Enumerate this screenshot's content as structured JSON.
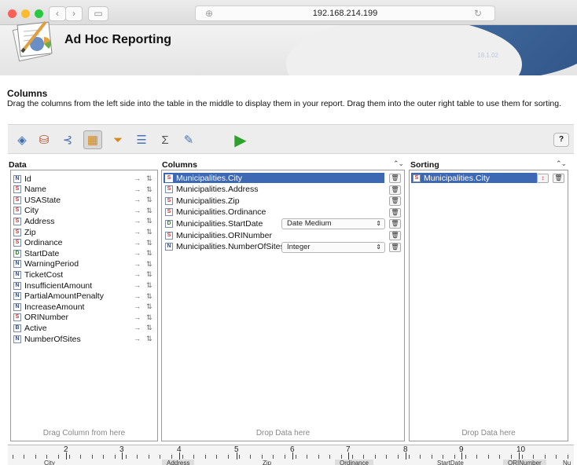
{
  "browser": {
    "url": "192.168.214.199"
  },
  "app": {
    "title": "Ad Hoc Reporting",
    "version": "18.1.02"
  },
  "section": {
    "title": "Columns",
    "description": "Drag the columns from the left side into the table in the middle to display them in your report. Drag them into the outer right table to use them for sorting."
  },
  "toolbar": {
    "items": [
      "datasource-icon",
      "database-icon",
      "relations-icon",
      "columns-icon",
      "filter-icon",
      "grouping-icon",
      "sum-icon",
      "edit-icon",
      "run-icon"
    ],
    "help_label": "?"
  },
  "data_panel": {
    "title": "Data",
    "footer": "Drag Column from here",
    "items": [
      {
        "type": "N",
        "label": "Id"
      },
      {
        "type": "S",
        "label": "Name"
      },
      {
        "type": "S",
        "label": "USAState"
      },
      {
        "type": "S",
        "label": "City"
      },
      {
        "type": "S",
        "label": "Address"
      },
      {
        "type": "S",
        "label": "Zip"
      },
      {
        "type": "S",
        "label": "Ordinance"
      },
      {
        "type": "D",
        "label": "StartDate"
      },
      {
        "type": "N",
        "label": "WarningPeriod"
      },
      {
        "type": "N",
        "label": "TicketCost"
      },
      {
        "type": "N",
        "label": "InsufficientAmount"
      },
      {
        "type": "N",
        "label": "PartialAmountPenalty"
      },
      {
        "type": "N",
        "label": "IncreaseAmount"
      },
      {
        "type": "S",
        "label": "ORINumber"
      },
      {
        "type": "B",
        "label": "Active"
      },
      {
        "type": "N",
        "label": "NumberOfSites"
      }
    ]
  },
  "columns_panel": {
    "title": "Columns",
    "footer": "Drop Data here",
    "items": [
      {
        "type": "S",
        "label": "Municipalities.City",
        "format": ""
      },
      {
        "type": "S",
        "label": "Municipalities.Address",
        "format": ""
      },
      {
        "type": "S",
        "label": "Municipalities.Zip",
        "format": ""
      },
      {
        "type": "S",
        "label": "Municipalities.Ordinance",
        "format": ""
      },
      {
        "type": "D",
        "label": "Municipalities.StartDate",
        "format": "Date Medium"
      },
      {
        "type": "S",
        "label": "Municipalities.ORINumber",
        "format": ""
      },
      {
        "type": "N",
        "label": "Municipalities.NumberOfSites",
        "format": "Integer"
      }
    ]
  },
  "sorting_panel": {
    "title": "Sorting",
    "footer": "Drop Data here",
    "items": [
      {
        "type": "S",
        "label": "Municipalities.City"
      }
    ]
  },
  "ruler": {
    "numbers": [
      "2",
      "3",
      "4",
      "5",
      "6",
      "7",
      "8",
      "9",
      "10"
    ],
    "labels": [
      "City",
      "Address",
      "Zip",
      "Ordinance",
      "StartDate",
      "ORINumber",
      "Nu"
    ]
  }
}
